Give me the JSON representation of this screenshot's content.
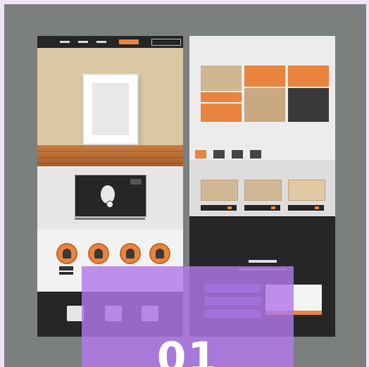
{
  "step_number": "01",
  "colors": {
    "page_background": "#efe3f7",
    "canvas_background": "#7b7f7e",
    "accent_orange": "#e9843f",
    "dark_section": "#262626",
    "overlay_purple": "#b278eb"
  },
  "icons": {
    "nav_menu": "menu-dashes-icon",
    "tv_play": "play-icon",
    "avatars": [
      "person-avatar-icon",
      "person-avatar-icon",
      "person-avatar-icon",
      "person-avatar-icon"
    ],
    "bottom_houses": [
      "house-icon",
      "house-icon",
      "house-icon"
    ],
    "category_tabs": [
      "category-icon",
      "category-icon",
      "category-icon",
      "category-icon"
    ]
  }
}
